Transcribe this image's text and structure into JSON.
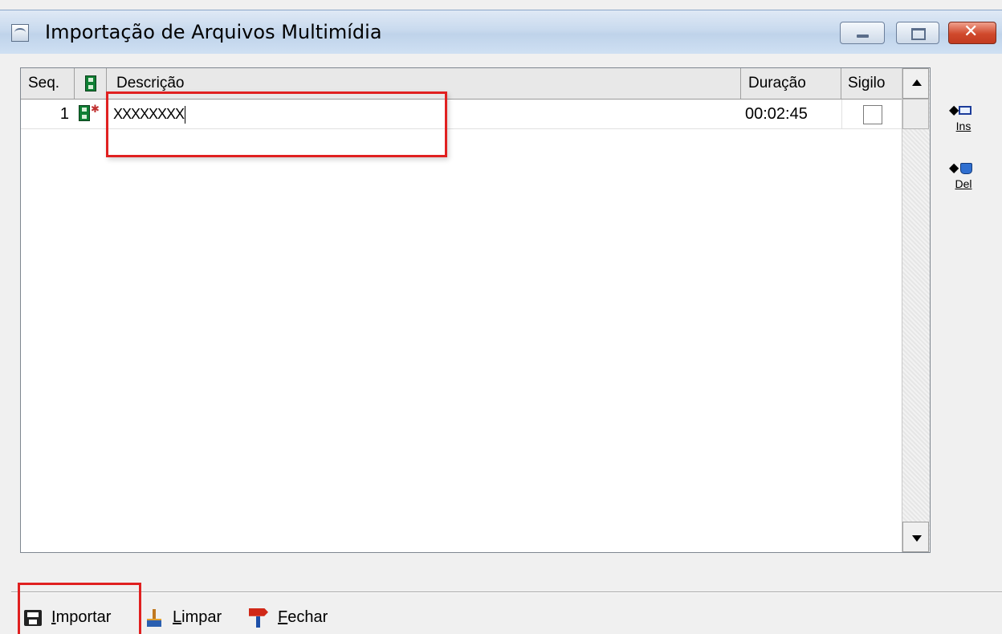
{
  "window": {
    "title": "Importação de Arquivos Multimídia",
    "icon": "app-icon",
    "controls": [
      "minimize-icon",
      "maximize-icon",
      "close-icon"
    ]
  },
  "grid": {
    "columns": {
      "seq": "Seq.",
      "media_icon": "film-icon",
      "description": "Descrição",
      "duration": "Duração",
      "secret": "Sigilo"
    },
    "rows": [
      {
        "seq": "1",
        "media_icon": "film-video-icon",
        "description": "XXXXXXXX",
        "duration": "00:02:45",
        "secret_checked": false
      }
    ]
  },
  "side_actions": {
    "insert_label": "Ins",
    "delete_label": "Del"
  },
  "toolbar": {
    "import_label_first": "I",
    "import_label_rest": "mportar",
    "clear_label_first": "L",
    "clear_label_rest": "impar",
    "close_label_first": "F",
    "close_label_rest": "echar"
  },
  "colors": {
    "highlight": "#e02020",
    "titlebar": "#c9daee",
    "close_button": "#d0492c"
  }
}
